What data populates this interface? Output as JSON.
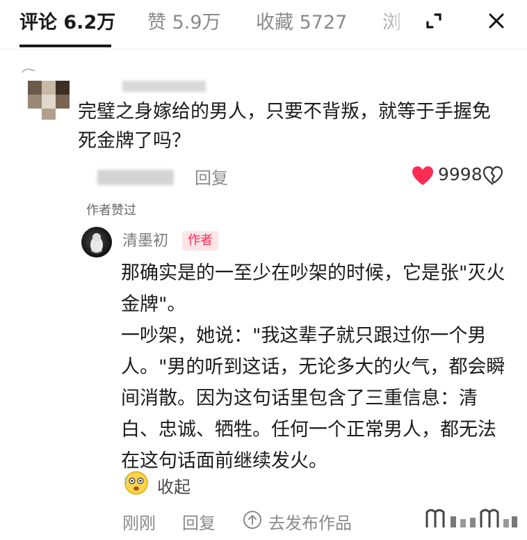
{
  "tabs": [
    {
      "label": "评论 6.2万"
    },
    {
      "label": "赞 5.9万"
    },
    {
      "label": "收藏 5727"
    },
    {
      "label": "浏"
    }
  ],
  "icons": {
    "expand": "expand-icon",
    "close": "close-icon",
    "heart": "heart-icon",
    "dislike": "broken-heart-icon",
    "emoji": "emoji-icon",
    "share": "share-icon"
  },
  "colors": {
    "accent_red": "#fe2c55",
    "text": "#1b1b1b",
    "muted": "#8a8a8a"
  },
  "comment": {
    "text": "完璧之身嫁给的男人，只要不背叛，就等于手握免死金牌了吗？",
    "reply_label": "回复",
    "like_count": "9998",
    "author_liked": "作者赞过"
  },
  "reply": {
    "name": "清墨初",
    "badge": "作者",
    "text": "那确实是的一至少在吵架的时候，它是张\"灭火金牌\"。\n一吵架，她说：\"我这辈子就只跟过你一个男人。\"男的听到这话，无论多大的火气，都会瞬间消散。因为这句话里包含了三重信息：清白、忠诚、牺牲。任何一个正常男人，都无法在这句话面前继续发火。",
    "collapse_label": "收起",
    "time": "刚刚",
    "reply_label": "回复",
    "post_label": "去发布作品"
  }
}
